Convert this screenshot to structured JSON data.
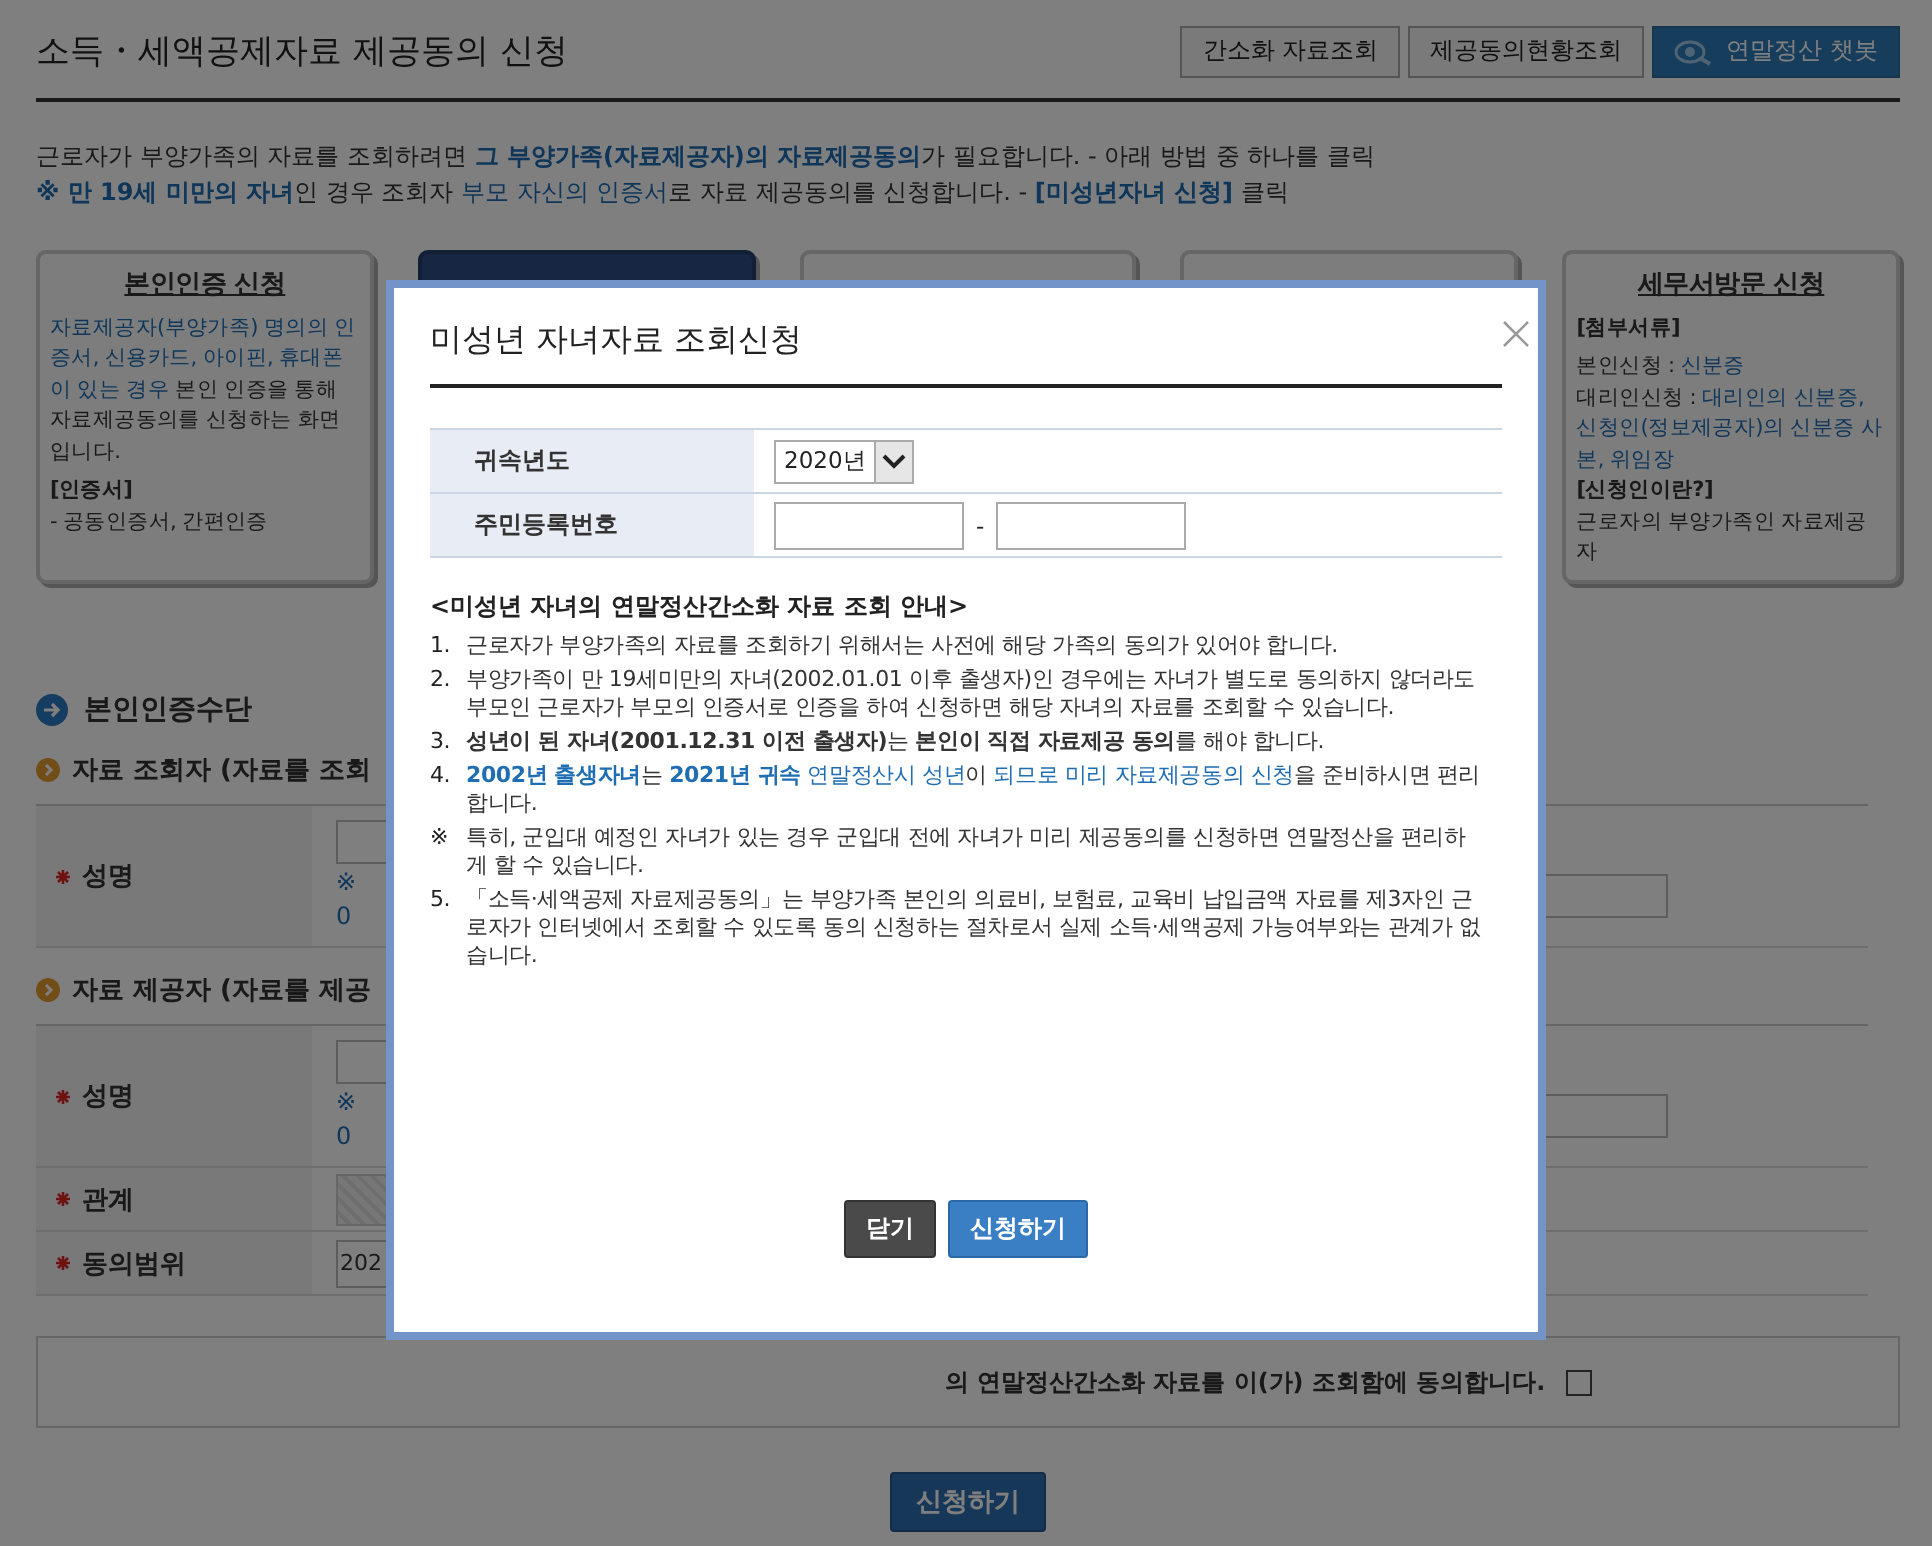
{
  "header": {
    "title": "소득・세액공제자료 제공동의 신청",
    "buttons": [
      {
        "label": "간소화 자료조회",
        "kind": "plain"
      },
      {
        "label": "제공동의현황조회",
        "kind": "plain"
      },
      {
        "label": "연말정산 챗봇",
        "kind": "chatbot"
      }
    ]
  },
  "intro": [
    [
      {
        "text": "근로자가 부양가족의 자료를 조회하려면 ",
        "kind": "plain"
      },
      {
        "text": "그 부양가족(자료제공자)의 자료제공동의",
        "kind": "link-bold"
      },
      {
        "text": "가 필요합니다. - 아래 방법 중 하나를 클릭",
        "kind": "plain"
      }
    ],
    [
      {
        "text": "※ 만 19세 미만의 자녀",
        "kind": "link-bold"
      },
      {
        "text": "인 경우 조회자 ",
        "kind": "plain"
      },
      {
        "text": "부모 자신의 인증서",
        "kind": "link"
      },
      {
        "text": "로 자료 제공동의를 신청합니다. - ",
        "kind": "plain"
      },
      {
        "text": "[미성년자녀 신청]",
        "kind": "link-bold"
      },
      {
        "text": " 클릭",
        "kind": "plain"
      }
    ]
  ],
  "cards": [
    {
      "selected": false,
      "title": "본인인증 신청",
      "paragraphs": [
        [
          {
            "text": "자료제공자(부양가족) 명의의 인증서, 신용카드, 아이핀, 휴대폰이 있는 경우",
            "kind": "link"
          },
          {
            "text": " 본인 인증을 통해 자료제공동의를 신청하는 화면입니다.",
            "kind": "plain"
          }
        ],
        [
          {
            "text": "[인증서]",
            "kind": "bold"
          }
        ],
        [
          {
            "text": "- 공동인증서, 간편인증",
            "kind": "plain"
          }
        ]
      ]
    },
    {
      "selected": true
    },
    {
      "selected": false
    },
    {
      "selected": false
    },
    {
      "selected": false,
      "title": "세무서방문 신청",
      "paragraphs": [
        [
          {
            "text": "[첨부서류]",
            "kind": "bold"
          }
        ],
        [
          {
            "text": "본인신청 : ",
            "kind": "plain"
          },
          {
            "text": "신분증",
            "kind": "link"
          }
        ],
        [
          {
            "text": "대리인신청 : ",
            "kind": "plain"
          },
          {
            "text": "대리인의 신분증, 신청인(정보제공자)의 신분증 사본, 위임장",
            "kind": "link"
          }
        ],
        [
          {
            "text": "[신청인이란?]",
            "kind": "bold"
          }
        ],
        [
          {
            "text": "근로자의 부양가족인 자료제공자",
            "kind": "plain"
          }
        ]
      ]
    }
  ],
  "section": {
    "title": "본인인증수단"
  },
  "groups": [
    {
      "title": "자료 조회자 (자료를 조회",
      "rows": [
        {
          "label": "성명",
          "kind": "name",
          "hint": [
            "※",
            "0"
          ]
        }
      ]
    },
    {
      "title": "자료 제공자 (자료를 제공",
      "rows": [
        {
          "label": "성명",
          "kind": "name",
          "hint": [
            "※",
            "0"
          ]
        },
        {
          "label": "관계",
          "kind": "disabled"
        },
        {
          "label": "동의범위",
          "kind": "select",
          "value": "202"
        }
      ]
    }
  ],
  "agreement": {
    "text": "의 연말정산간소화 자료를 이(가) 조회함에 동의합니다.",
    "checked": false
  },
  "submit": "신청하기",
  "modal": {
    "title": "미성년 자녀자료 조회신청",
    "form": [
      {
        "label": "귀속년도",
        "kind": "select",
        "value": "2020년"
      },
      {
        "label": "주민등록번호",
        "kind": "rrn",
        "separator": "-"
      }
    ],
    "notice_title": "<미성년 자녀의 연말정산간소화 자료 조회 안내>",
    "items": [
      {
        "marker": "1.",
        "segments": [
          {
            "text": "근로자가 부양가족의 자료를 조회하기 위해서는 사전에 해당 가족의 동의가 있어야 합니다.",
            "kind": "plain"
          }
        ]
      },
      {
        "marker": "2.",
        "segments": [
          {
            "text": "부양가족이 만 19세미만의 자녀(2002.01.01 이후 출생자)인 경우에는 자녀가 별도로 동의하지 않더라도 부모인 근로자가 부모의 인증서로 인증을 하여 신청하면 해당 자녀의 자료를 조회할 수 있습니다.",
            "kind": "plain"
          }
        ]
      },
      {
        "marker": "3.",
        "segments": [
          {
            "text": "성년이 된 자녀(2001.12.31 이전 출생자)",
            "kind": "bold"
          },
          {
            "text": "는 ",
            "kind": "plain"
          },
          {
            "text": "본인이 직접 자료제공 동의",
            "kind": "bold"
          },
          {
            "text": "를 해야 합니다.",
            "kind": "plain"
          }
        ]
      },
      {
        "marker": "4.",
        "segments": [
          {
            "text": "2002년 출생자녀",
            "kind": "link-bold"
          },
          {
            "text": "는 ",
            "kind": "plain"
          },
          {
            "text": "2021년 귀속",
            "kind": "link-bold"
          },
          {
            "text": " 연말정산시 성년",
            "kind": "link"
          },
          {
            "text": "이 ",
            "kind": "plain"
          },
          {
            "text": "되므로 미리 자료제공동의 신청",
            "kind": "link"
          },
          {
            "text": "을 준비하시면 편리합니다.",
            "kind": "plain"
          }
        ]
      },
      {
        "marker": "※",
        "segments": [
          {
            "text": "특히, 군입대 예정인 자녀가 있는 경우 군입대 전에 자녀가 미리 제공동의를 신청하면 연말정산을 편리하게 할 수 있습니다.",
            "kind": "plain"
          }
        ]
      },
      {
        "marker": "5.",
        "segments": [
          {
            "text": "「소득·세액공제 자료제공동의」는 부양가족 본인의 의료비, 보험료, 교육비 납입금액 자료를 제3자인 근로자가 인터넷에서 조회할 수 있도록 동의 신청하는 절차로서 실제 소득·세액공제 가능여부와는 관계가 없습니다.",
            "kind": "plain"
          }
        ]
      }
    ],
    "buttons": [
      {
        "label": "닫기",
        "kind": "secondary"
      },
      {
        "label": "신청하기",
        "kind": "primary"
      }
    ]
  }
}
